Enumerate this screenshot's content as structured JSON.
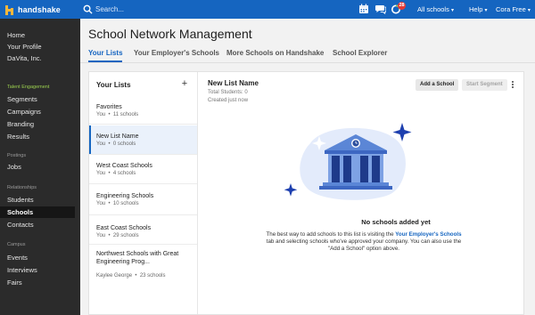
{
  "brand": {
    "name": "handshake",
    "primary": "#1565c0",
    "accent_green": "#9bd04f"
  },
  "topbar": {
    "search_placeholder": "Search...",
    "icons": [
      "calendar-icon",
      "chat-icon",
      "notifications-icon"
    ],
    "notification_count": "28",
    "schools_menu": "All schools",
    "help_menu": "Help",
    "user_menu": "Cora Free"
  },
  "sidebar": {
    "top_items": [
      "Home",
      "Your Profile",
      "DaVita, Inc."
    ],
    "talent_section": "Talent Engagement",
    "talent_items": [
      "Segments",
      "Campaigns",
      "Branding",
      "Results"
    ],
    "postings_section": "Postings",
    "postings_items": [
      "Jobs"
    ],
    "relationships_section": "Relationships",
    "relationships_items": [
      "Students",
      "Schools",
      "Contacts"
    ],
    "campus_section": "Campus",
    "campus_items": [
      "Events",
      "Interviews",
      "Fairs"
    ],
    "active_item": "Schools"
  },
  "page": {
    "title": "School Network Management",
    "tabs": [
      "Your Lists",
      "Your Employer's Schools",
      "More Schools on Handshake",
      "School Explorer"
    ],
    "active_tab": "Your Lists"
  },
  "lists_panel": {
    "title": "Your Lists",
    "add_icon": "plus-icon",
    "items": [
      {
        "name": "Favorites",
        "owner": "You",
        "count": "11 schools"
      },
      {
        "name": "New List Name",
        "owner": "You",
        "count": "0 schools",
        "selected": true
      },
      {
        "name": "West Coast Schools",
        "owner": "You",
        "count": "4 schools"
      },
      {
        "name": "Engineering Schools",
        "owner": "You",
        "count": "10 schools"
      },
      {
        "name": "East Coast Schools",
        "owner": "You",
        "count": "29 schools"
      },
      {
        "name": "Northwest Schools with Great Engineering Prog...",
        "owner": "Kaylee George",
        "count": "23 schools"
      }
    ]
  },
  "detail": {
    "title": "New List Name",
    "total_students": "Total Students: 0",
    "created": "Created just now",
    "add_button": "Add a School",
    "start_button": "Start Segment",
    "empty_title": "No schools added yet",
    "empty_text_1": "The best way to add schools to this list is visiting the ",
    "empty_link": "Your Employer's Schools",
    "empty_text_2": " tab and selecting schools who've approved your company. You can also use the \"Add a School\" option above."
  }
}
